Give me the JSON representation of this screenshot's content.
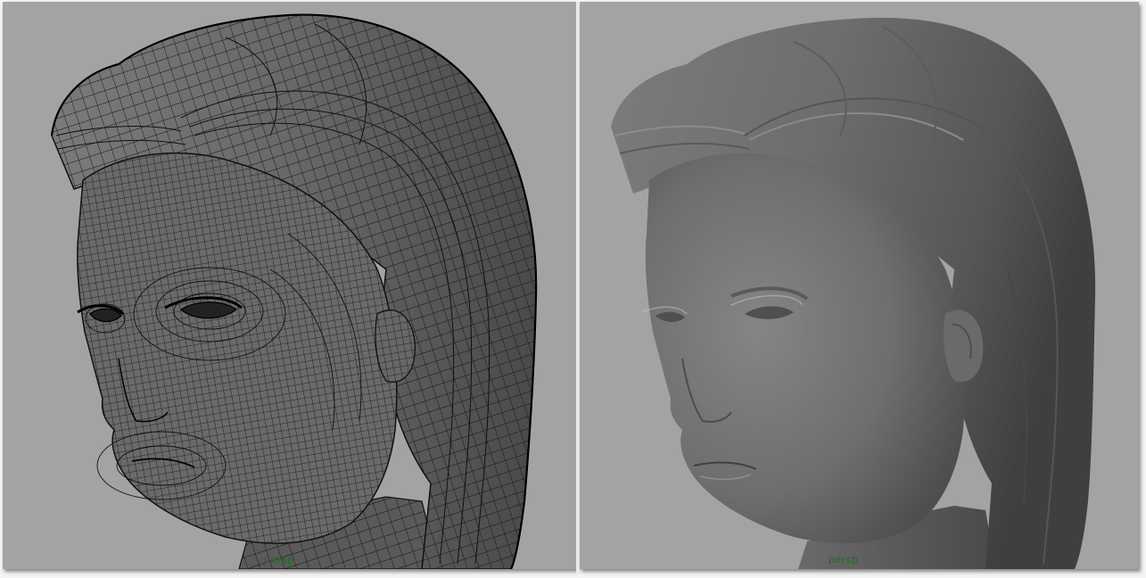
{
  "viewports": [
    {
      "camera_label": "persp",
      "display_mode": "wireframe-on-shaded"
    },
    {
      "camera_label": "persp",
      "display_mode": "smooth-shaded"
    }
  ],
  "colors": {
    "viewport_background": "#a3a3a3",
    "mesh_fill": "#5f5f5f",
    "wire_color": "#111111",
    "camera_label_color": "#1e6b1e"
  }
}
